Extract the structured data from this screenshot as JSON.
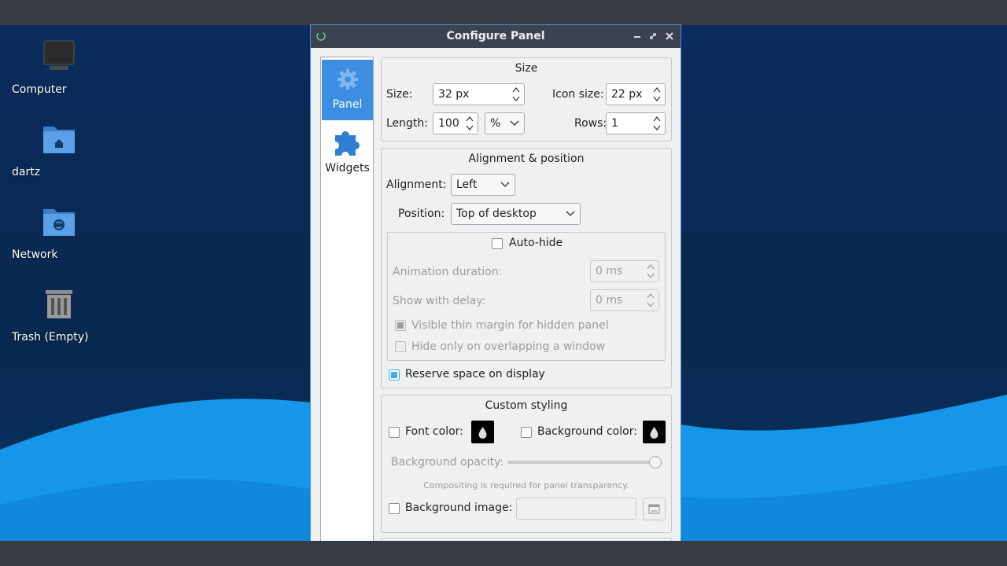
{
  "desktop": {
    "icons": [
      {
        "name": "computer-desktop-icon",
        "label": "Computer"
      },
      {
        "name": "home-folder-desktop-icon",
        "label": "dartz"
      },
      {
        "name": "network-desktop-icon",
        "label": "Network"
      },
      {
        "name": "trash-desktop-icon",
        "label": "Trash (Empty)"
      }
    ]
  },
  "window": {
    "title": "Configure Panel",
    "controls": {
      "minimize": "minimize-icon",
      "restore": "restore-icon",
      "close": "close-icon"
    }
  },
  "sidebar": {
    "items": [
      {
        "label": "Panel",
        "icon": "gear-icon",
        "active": true
      },
      {
        "label": "Widgets",
        "icon": "puzzle-icon",
        "active": false
      }
    ]
  },
  "size_group": {
    "title": "Size",
    "size_label": "Size:",
    "size_value": "32 px",
    "icon_size_label": "Icon size:",
    "icon_size_value": "22 px",
    "length_label": "Length:",
    "length_value": "100",
    "length_unit": "%",
    "rows_label": "Rows:",
    "rows_value": "1"
  },
  "alignment_group": {
    "title": "Alignment & position",
    "alignment_label": "Alignment:",
    "alignment_value": "Left",
    "position_label": "Position:",
    "position_value": "Top of desktop",
    "autohide_label": "Auto-hide",
    "animation_label": "Animation duration:",
    "animation_value": "0 ms",
    "delay_label": "Show with delay:",
    "delay_value": "0 ms",
    "thin_margin_label": "Visible thin margin for hidden panel",
    "overlap_label": "Hide only on overlapping a window",
    "reserve_label": "Reserve space on display"
  },
  "styling_group": {
    "title": "Custom styling",
    "font_color_label": "Font color:",
    "bg_color_label": "Background color:",
    "opacity_label": "Background opacity:",
    "opacity_value_fraction": 1.0,
    "compositing_note": "Compositing is required for panel transparency.",
    "bg_image_label": "Background image:"
  },
  "colors": {
    "accent": "#3daee9",
    "sidebar_active": "#3d8ee0",
    "titlebar": "#3d4250"
  }
}
